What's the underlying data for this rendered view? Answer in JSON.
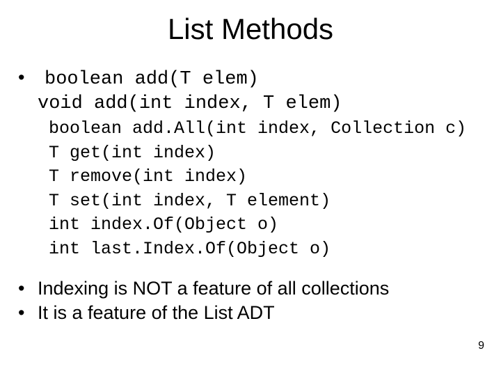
{
  "title": "List Methods",
  "first_bullet_line1": "boolean  add(T elem)",
  "first_bullet_line2": "void add(int index, T elem)",
  "code_lines": {
    "l1": "boolean add.All(int index, Collection c)",
    "l2": "T get(int index)",
    "l3": "T remove(int index)",
    "l4": "T set(int index, T element)",
    "l5": "int index.Of(Object o)",
    "l6": "int last.Index.Of(Object o)"
  },
  "bottom": {
    "b1": "Indexing is NOT a feature of all collections",
    "b2": "It is a feature of the List ADT"
  },
  "page_number": "9"
}
